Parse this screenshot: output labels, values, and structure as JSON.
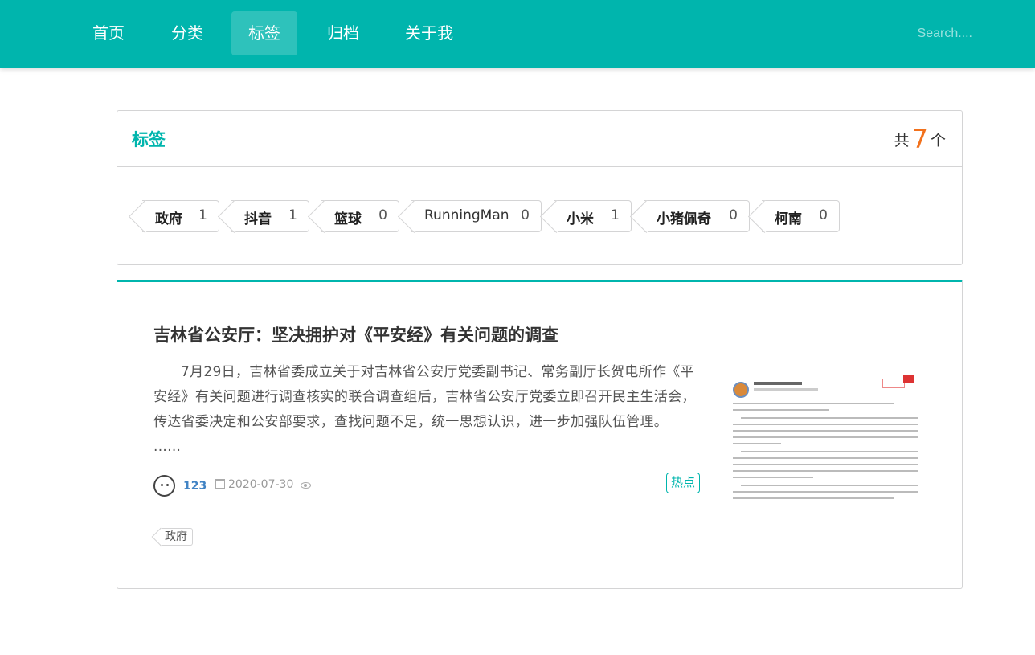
{
  "nav": {
    "items": [
      {
        "label": "首页"
      },
      {
        "label": "分类"
      },
      {
        "label": "标签"
      },
      {
        "label": "归档"
      },
      {
        "label": "关于我"
      }
    ],
    "active": "标签",
    "search_placeholder": "Search...."
  },
  "tags_panel": {
    "title": "标签",
    "count_prefix": "共",
    "count": "7",
    "count_suffix": "个",
    "tags": [
      {
        "name": "政府",
        "count": "1"
      },
      {
        "name": "抖音",
        "count": "1"
      },
      {
        "name": "篮球",
        "count": "0"
      },
      {
        "name": "RunningMan",
        "count": "0"
      },
      {
        "name": "小米",
        "count": "1"
      },
      {
        "name": "小猪佩奇",
        "count": "0"
      },
      {
        "name": "柯南",
        "count": "0"
      }
    ]
  },
  "article": {
    "title": "吉林省公安厅：坚决拥护对《平安经》有关问题的调查",
    "excerpt": "7月29日，吉林省委成立关于对吉林省公安厅党委副书记、常务副厅长贺电所作《平安经》有关问题进行调查核实的联合调查组后，吉林省公安厅党委立即召开民主生活会，传达省委决定和公安部要求，查找问题不足，统一思想认识，进一步加强队伍管理。 ......",
    "author": "123",
    "date": "2020-07-30",
    "category_label": "热点",
    "tag": "政府"
  },
  "colors": {
    "primary": "#00b5ad",
    "count_accent": "#f2711c",
    "author_link": "#4183c4"
  },
  "icons": [
    "calendar-icon",
    "eye-icon",
    "avatar"
  ]
}
